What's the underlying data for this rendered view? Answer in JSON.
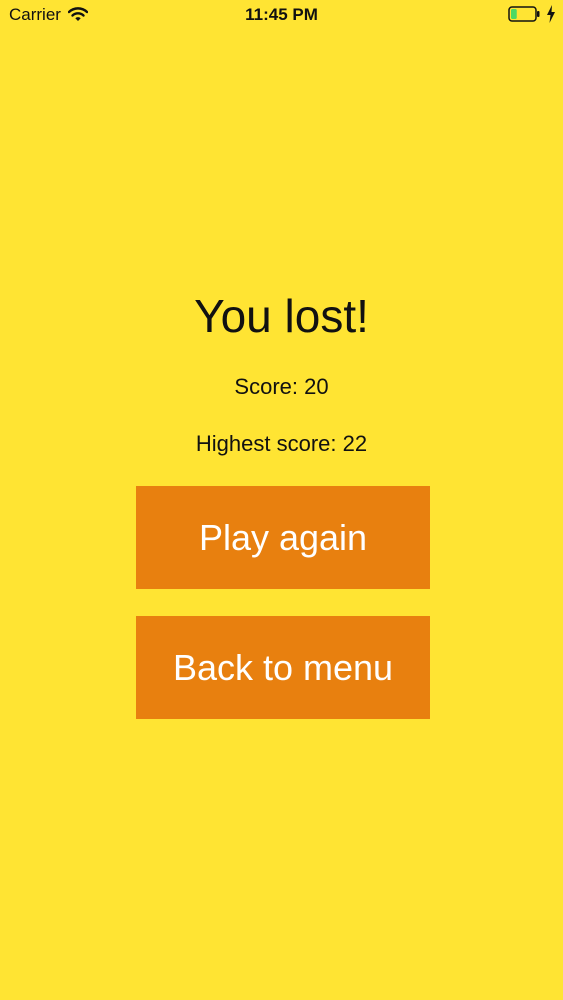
{
  "status_bar": {
    "carrier": "Carrier",
    "time": "11:45 PM",
    "wifi_icon": "wifi-icon",
    "battery_icon": "battery-icon",
    "battery_level": 0.25,
    "battery_fill_color": "#4CD964",
    "charging_icon": "charging-bolt-icon"
  },
  "game_over": {
    "title": "You lost!",
    "score_text": "Score: 20",
    "highest_score_text": "Highest score: 22"
  },
  "buttons": {
    "play_again": "Play again",
    "back_to_menu": "Back to menu"
  },
  "colors": {
    "background": "#FFE433",
    "button": "#E8800F",
    "button_text": "#FFFFFF"
  }
}
